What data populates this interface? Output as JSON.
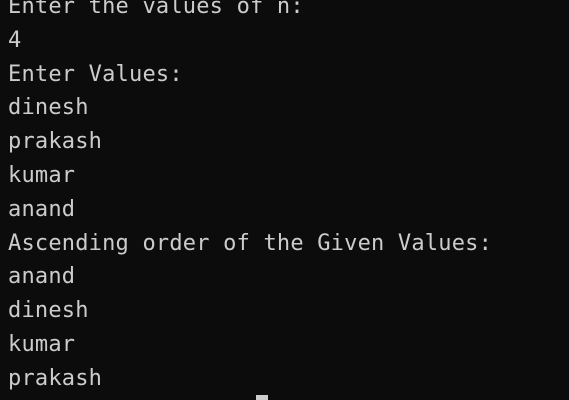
{
  "terminal": {
    "lines": [
      "Enter the values of n:",
      "4",
      "Enter Values:",
      "dinesh",
      "prakash",
      "kumar",
      "anand",
      "Ascending order of the Given Values:",
      "anand",
      "dinesh",
      "kumar",
      "prakash"
    ],
    "colors": {
      "background": "#0c0c0c",
      "text": "#cccccc"
    }
  }
}
